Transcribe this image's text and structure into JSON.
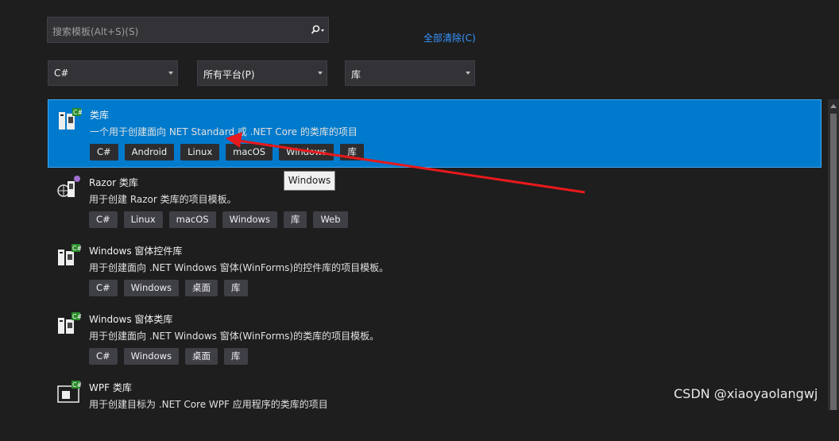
{
  "search": {
    "placeholder": "搜索模板(Alt+S)(S)"
  },
  "clear_all": "全部清除(C)",
  "filters": {
    "language": "C#",
    "platform": "所有平台(P)",
    "project_type": "库"
  },
  "templates": [
    {
      "name": "类库",
      "desc": "一个用于创建面向 NET Standard 或 .NET Core 的类库的项目",
      "tags": [
        "C#",
        "Android",
        "Linux",
        "macOS",
        "Windows",
        "库"
      ],
      "selected": true,
      "icon": "class-library-icon"
    },
    {
      "name": "Razor 类库",
      "desc": "用于创建 Razor 类库的项目模板。",
      "tags": [
        "C#",
        "Linux",
        "macOS",
        "Windows",
        "库",
        "Web"
      ],
      "icon": "razor-library-icon"
    },
    {
      "name": "Windows 窗体控件库",
      "desc": "用于创建面向 .NET Windows 窗体(WinForms)的控件库的项目模板。",
      "tags": [
        "C#",
        "Windows",
        "桌面",
        "库"
      ],
      "icon": "winforms-control-library-icon"
    },
    {
      "name": "Windows 窗体类库",
      "desc": "用于创建面向 .NET Windows 窗体(WinForms)的类库的项目模板。",
      "tags": [
        "C#",
        "Windows",
        "桌面",
        "库"
      ],
      "icon": "winforms-class-library-icon"
    },
    {
      "name": "WPF 类库",
      "desc": "用于创建目标为 .NET Core WPF 应用程序的类库的项目",
      "tags": [],
      "icon": "wpf-library-icon"
    }
  ],
  "tooltip": "Windows",
  "watermark": "CSDN @xiaoyaolangwj",
  "colors": {
    "selected": "#007acc",
    "link": "#3794ff",
    "annotation": "#e8191c"
  }
}
